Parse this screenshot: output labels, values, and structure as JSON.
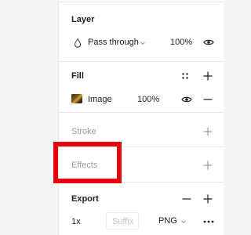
{
  "layer": {
    "title": "Layer",
    "blend_mode": "Pass through",
    "opacity": "100%"
  },
  "fill": {
    "title": "Fill",
    "type": "Image",
    "opacity": "100%"
  },
  "stroke": {
    "title": "Stroke"
  },
  "effects": {
    "title": "Effects",
    "highlight_color": "#e8000e"
  },
  "export": {
    "title": "Export",
    "scale": "1x",
    "suffix_placeholder": "Suffix",
    "format": "PNG"
  },
  "icons": [
    "drop-icon",
    "chevron-down-icon",
    "eye-icon",
    "styles-grid-icon",
    "plus-icon",
    "minus-icon",
    "more-icon"
  ]
}
